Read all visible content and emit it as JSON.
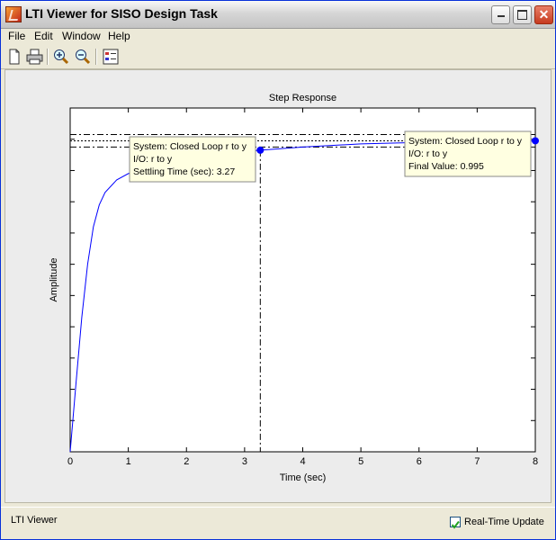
{
  "window": {
    "title": "LTI Viewer for SISO Design Task"
  },
  "menu": [
    "File",
    "Edit",
    "Window",
    "Help"
  ],
  "toolbar": {
    "icons": [
      "new-document-icon",
      "print-icon",
      "zoom-in-icon",
      "zoom-out-icon",
      "legend-icon"
    ]
  },
  "plot": {
    "title": "Step Response",
    "xlabel": "Time (sec)",
    "ylabel": "Amplitude",
    "xticks": [
      "0",
      "1",
      "2",
      "3",
      "4",
      "5",
      "6",
      "7",
      "8"
    ]
  },
  "datatip_settling": {
    "line1": "System: Closed Loop r to y",
    "line2": "I/O: r to y",
    "line3": "Settling Time (sec): 3.27"
  },
  "datatip_final": {
    "line1": "System: Closed Loop r to y",
    "line2": "I/O: r to y",
    "line3": "Final Value: 0.995"
  },
  "status": {
    "left_text": "LTI Viewer",
    "realtime_label": "Real-Time Update",
    "realtime_checked": true
  },
  "colors": {
    "curve": "#0000ff",
    "tip_bg": "#ffffe1"
  },
  "chart_data": {
    "type": "line",
    "title": "Step Response",
    "xlabel": "Time (sec)",
    "ylabel": "Amplitude",
    "xlim": [
      0,
      8
    ],
    "ylim": [
      0,
      1.1
    ],
    "series": [
      {
        "name": "Closed Loop r to y",
        "x": [
          0,
          0.1,
          0.2,
          0.3,
          0.4,
          0.5,
          0.6,
          0.8,
          1.0,
          1.5,
          2.0,
          2.5,
          3.0,
          3.27,
          4.0,
          5.0,
          6.0,
          7.0,
          8.0
        ],
        "y": [
          0,
          0.22,
          0.43,
          0.6,
          0.72,
          0.79,
          0.83,
          0.87,
          0.89,
          0.915,
          0.935,
          0.95,
          0.96,
          0.965,
          0.975,
          0.985,
          0.99,
          0.993,
          0.995
        ]
      }
    ],
    "annotations": [
      {
        "label": "Settling Time (sec): 3.27",
        "x": 3.27,
        "y": 0.965
      },
      {
        "label": "Final Value: 0.995",
        "x": 8,
        "y": 0.995
      }
    ],
    "reference_lines": {
      "final_value": 0.995,
      "upper_band": 1.015,
      "lower_band": 0.975
    }
  }
}
